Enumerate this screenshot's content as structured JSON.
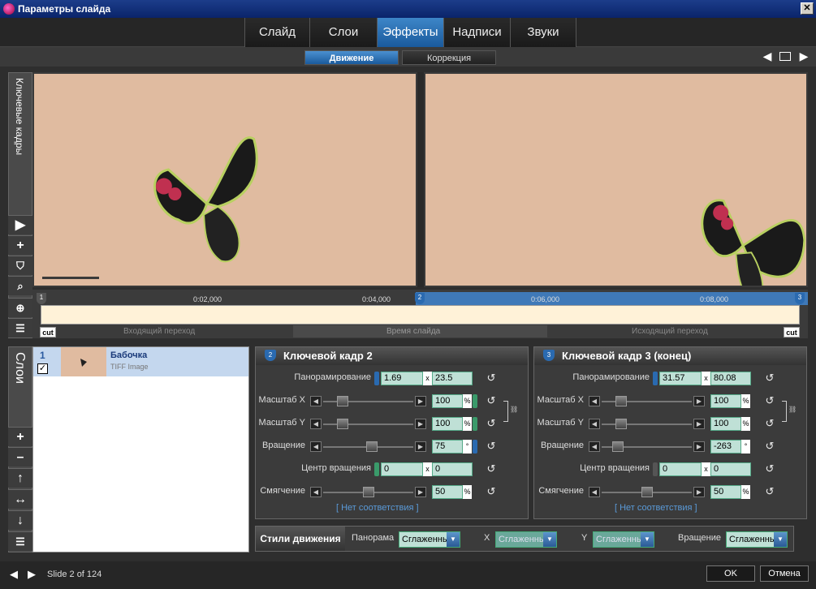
{
  "window": {
    "title": "Параметры слайда",
    "close": "✕"
  },
  "tabs": [
    {
      "label": "Слайд",
      "active": false
    },
    {
      "label": "Слои",
      "active": false
    },
    {
      "label": "Эффекты",
      "active": true
    },
    {
      "label": "Надписи",
      "active": false
    },
    {
      "label": "Звуки",
      "active": false
    }
  ],
  "subtabs": [
    {
      "label": "Движение",
      "active": true
    },
    {
      "label": "Коррекция",
      "active": false
    }
  ],
  "keyframes_panel": {
    "label": "Ключевые кадры"
  },
  "timeline": {
    "ticks": [
      "0:02,000",
      "0:04,000",
      "0:06,000",
      "0:08,000"
    ],
    "markers": [
      "1",
      "2",
      "3"
    ],
    "in_transition": "Входящий переход",
    "slide_time": "Время слайда",
    "out_transition": "Исходящий переход",
    "cut": "cut"
  },
  "layers_panel": {
    "label": "Слои"
  },
  "layer": {
    "index": "1",
    "name": "Бабочка",
    "type": "TIFF Image"
  },
  "kf2": {
    "title": "Ключевой кадр 2",
    "badge": "2",
    "pan_label": "Панорамирование",
    "pan_x": "1.69",
    "pan_y": "23.5",
    "scale_x_label": "Масштаб X",
    "scale_x": "100",
    "scale_y_label": "Масштаб Y",
    "scale_y": "100",
    "rotation_label": "Вращение",
    "rotation": "75",
    "center_label": "Центр вращения",
    "center_x": "0",
    "center_y": "0",
    "smooth_label": "Смягчение",
    "smooth": "50",
    "nomatch": "[ Нет соответствия ]"
  },
  "kf3": {
    "title": "Ключевой кадр 3 (конец)",
    "badge": "3",
    "pan_label": "Панорамирование",
    "pan_x": "31.57",
    "pan_y": "80.08",
    "scale_x_label": "Масштаб X",
    "scale_x": "100",
    "scale_y_label": "Масштаб Y",
    "scale_y": "100",
    "rotation_label": "Вращение",
    "rotation": "-263",
    "center_label": "Центр вращения",
    "center_x": "0",
    "center_y": "0",
    "smooth_label": "Смягчение",
    "smooth": "50",
    "nomatch": "[ Нет соответствия ]"
  },
  "units": {
    "x": "x",
    "percent": "%",
    "degree": "°"
  },
  "motion_styles": {
    "title": "Стили движения",
    "pan_label": "Панорама",
    "pan_value": "Сглаженнь",
    "x_label": "X",
    "x_value": "Сглаженнь",
    "y_label": "Y",
    "y_value": "Сглаженнь",
    "rot_label": "Вращение",
    "rot_value": "Сглаженнь"
  },
  "footer": {
    "slide_info": "Slide 2 of 124",
    "ok": "OK",
    "cancel": "Отмена"
  },
  "colors": {
    "accent": "#2a6ab0",
    "field": "#bfe0d6",
    "preview_bg": "#e0bba0"
  }
}
